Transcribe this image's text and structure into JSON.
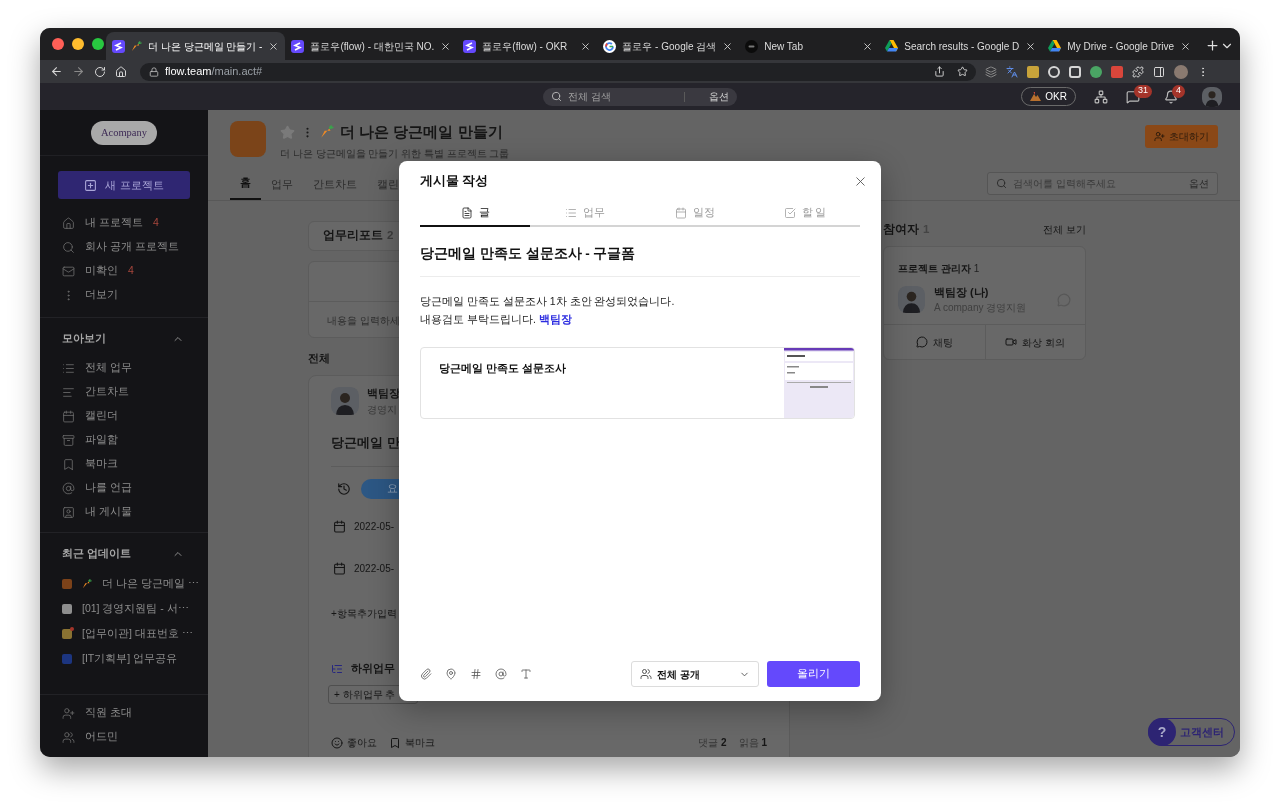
{
  "browser": {
    "tabs": [
      {
        "title": "더 나은 당근메일 만들기 -",
        "selected": true
      },
      {
        "title": "플로우(flow) - 대한민국 NO.",
        "selected": false
      },
      {
        "title": "플로우(flow) - OKR",
        "selected": false
      },
      {
        "title": "플로우 - Google 검색",
        "selected": false
      },
      {
        "title": "New Tab",
        "selected": false
      },
      {
        "title": "Search results - Google D",
        "selected": false
      },
      {
        "title": "My Drive - Google Drive",
        "selected": false
      }
    ],
    "url": {
      "host": "flow.team",
      "path": "/main.act#"
    }
  },
  "topbar": {
    "search": {
      "placeholder": "전체 검색",
      "option": "옵션"
    },
    "okr": "OKR",
    "chat_badge": "31",
    "alarm_badge": "4"
  },
  "sidebar": {
    "logo": "Acompany",
    "new_project": "새 프로젝트",
    "nav": [
      {
        "label": "내 프로젝트",
        "count": "4"
      },
      {
        "label": "회사 공개 프로젝트"
      },
      {
        "label": "미확인",
        "count": "4"
      },
      {
        "label": "더보기"
      }
    ],
    "views": {
      "title": "모아보기",
      "expanded": true,
      "items": [
        {
          "label": "전체 업무"
        },
        {
          "label": "간트차트"
        },
        {
          "label": "캘린더"
        },
        {
          "label": "파일함"
        },
        {
          "label": "북마크"
        },
        {
          "label": "나를 언급"
        },
        {
          "label": "내 게시물"
        }
      ]
    },
    "recent": {
      "title": "최근 업데이트",
      "expanded": true,
      "items": [
        {
          "label": "더 나은 당근메일 ⋯",
          "color": "#7c4219",
          "unread": false
        },
        {
          "label": "[01] 경영지원팀 - 서⋯",
          "color": "#8e8e8e",
          "unread": false
        },
        {
          "label": "[업무이관] 대표번호 ⋯",
          "color": "#8a7232",
          "unread": true
        },
        {
          "label": "[IT기획부] 업무공유",
          "color": "#1c3580",
          "unread": false
        }
      ]
    },
    "footer": [
      {
        "label": "직원 초대"
      },
      {
        "label": "어드민"
      }
    ]
  },
  "project": {
    "title": "더 나은 당근메일 만들기",
    "favorite": false,
    "subtitle": "더 나은 당근메일을 만들기 위한 특별 프로젝트 그룹",
    "invite": "초대하기",
    "tabs": [
      {
        "label": "홈",
        "selected": true
      },
      {
        "label": "업무",
        "selected": false
      },
      {
        "label": "간트차트",
        "selected": false
      },
      {
        "label": "캘린",
        "selected": false
      }
    ],
    "search": {
      "placeholder": "검색어를 입력해주세요",
      "option": "옵션"
    }
  },
  "feed": {
    "report": {
      "label": "업무리포트",
      "count": "2"
    },
    "composer_placeholder": "내용을 입력하세",
    "section": "전체",
    "post": {
      "author": "백팀장",
      "dept": "경영지",
      "title": "당근메일 만",
      "status": "요",
      "dates": [
        "2022-05-",
        "2022-05-"
      ],
      "add_field": "+항목추가입력",
      "subtasks": "하위업무",
      "add_subtask": "+ 하위업무 추",
      "like": "좋아요",
      "bookmark": "북마크",
      "comments": "댓글",
      "comment_count": "2",
      "reads": "읽음",
      "read_count": "1"
    }
  },
  "participants": {
    "title": "참여자",
    "count": "1",
    "view_all": "전체 보기",
    "group": "프로젝트 관리자",
    "group_count": "1",
    "member": {
      "name": "백팀장 (나)",
      "org": "A company 경영지원"
    },
    "actions": [
      {
        "label": "채팅"
      },
      {
        "label": "화상 회의"
      }
    ]
  },
  "help": {
    "mark": "?",
    "label": "고객센터"
  },
  "modal": {
    "title": "게시물 작성",
    "tabs": [
      {
        "label": "글",
        "selected": true
      },
      {
        "label": "업무",
        "selected": false
      },
      {
        "label": "일정",
        "selected": false
      },
      {
        "label": "할 일",
        "selected": false
      }
    ],
    "post_title": "당근메일 만족도 설문조사 - 구글폼",
    "body": [
      {
        "text": "당근메일 만족도 설문조사 1차 초안 완성되었습니다."
      },
      {
        "text": "내용검토 부탁드립니다.",
        "mention": "백팀장"
      }
    ],
    "link_preview": {
      "title": "당근메일 만족도 설문조사"
    },
    "visibility": "전체 공개",
    "submit": "올리기"
  }
}
